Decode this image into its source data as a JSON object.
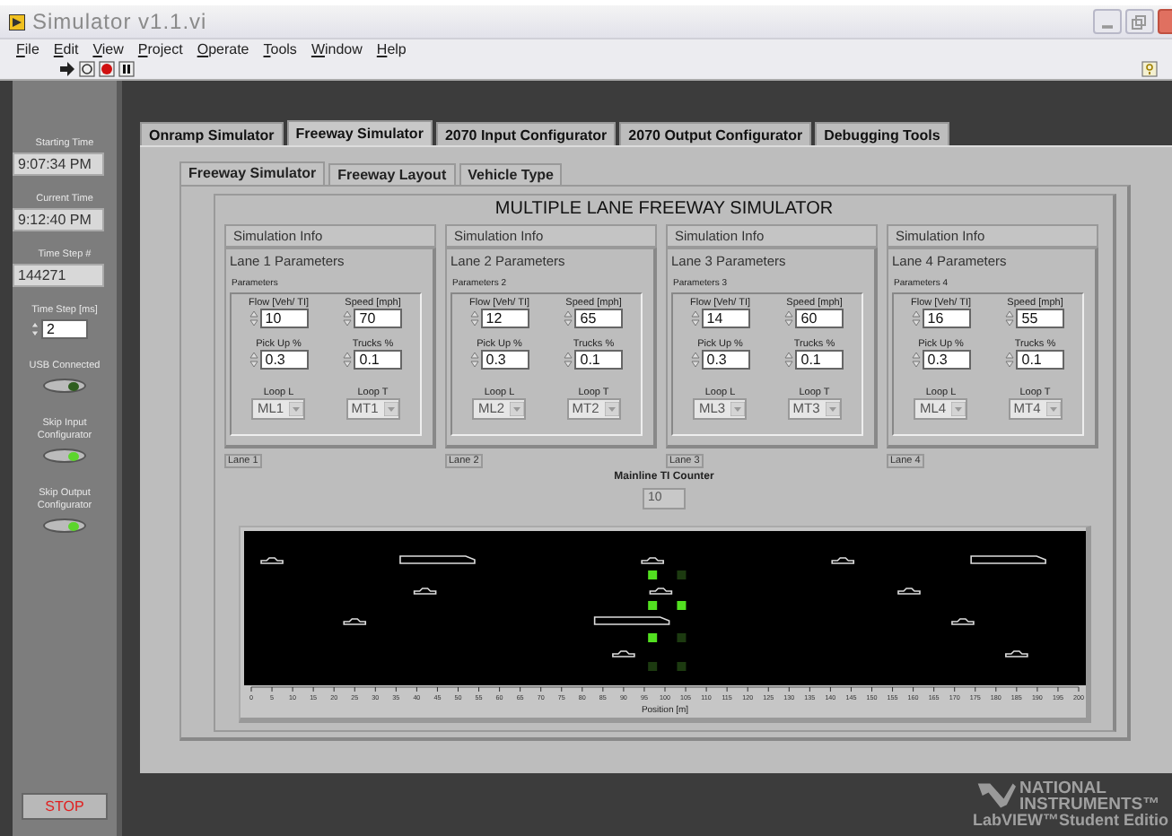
{
  "window": {
    "title": "Simulator v1.1.vi"
  },
  "menu": [
    "File",
    "Edit",
    "View",
    "Project",
    "Operate",
    "Tools",
    "Window",
    "Help"
  ],
  "side_panel": {
    "displays": [
      {
        "label": "Starting Time",
        "value": "9:07:34 PM"
      },
      {
        "label": "Current Time",
        "value": "9:12:40 PM"
      },
      {
        "label": "Time Step #",
        "value": "144271"
      }
    ],
    "time_step": {
      "label": "Time Step [ms]",
      "value": "2"
    },
    "leds": [
      {
        "label": "USB Connected",
        "on": false
      },
      {
        "label": "Skip Input Configurator",
        "on": true
      },
      {
        "label": "Skip Output Configurator",
        "on": true
      }
    ],
    "stop_button": "STOP"
  },
  "tabs": [
    {
      "label": "Onramp Simulator",
      "selected": false
    },
    {
      "label": "Freeway Simulator",
      "selected": true
    },
    {
      "label": "2070 Input Configurator",
      "selected": false
    },
    {
      "label": "2070 Output Configurator",
      "selected": false
    },
    {
      "label": "Debugging Tools",
      "selected": false
    }
  ],
  "sub_tabs": [
    {
      "label": "Freeway Simulator",
      "selected": true
    },
    {
      "label": "Freeway Layout",
      "selected": false
    },
    {
      "label": "Vehicle Type",
      "selected": false
    }
  ],
  "panel_title": "MULTIPLE LANE FREEWAY SIMULATOR",
  "lanes": [
    {
      "tab": "Simulation Info",
      "title": "Lane 1 Parameters",
      "cluster": "Parameters",
      "fields": [
        {
          "label": "Flow [Veh/ TI]",
          "value": "10"
        },
        {
          "label": "Speed [mph]",
          "value": "70"
        },
        {
          "label": "Pick Up %",
          "value": "0.3"
        },
        {
          "label": "Trucks %",
          "value": "0.1"
        }
      ],
      "loops": [
        {
          "label": "Loop L",
          "value": "ML1"
        },
        {
          "label": "Loop T",
          "value": "MT1"
        }
      ],
      "caption": "Lane 1"
    },
    {
      "tab": "Simulation Info",
      "title": "Lane 2 Parameters",
      "cluster": "Parameters 2",
      "fields": [
        {
          "label": "Flow [Veh/ TI]",
          "value": "12"
        },
        {
          "label": "Speed [mph]",
          "value": "65"
        },
        {
          "label": "Pick Up %",
          "value": "0.3"
        },
        {
          "label": "Trucks %",
          "value": "0.1"
        }
      ],
      "loops": [
        {
          "label": "Loop L",
          "value": "ML2"
        },
        {
          "label": "Loop T",
          "value": "MT2"
        }
      ],
      "caption": "Lane 2"
    },
    {
      "tab": "Simulation Info",
      "title": "Lane 3 Parameters",
      "cluster": "Parameters 3",
      "fields": [
        {
          "label": "Flow [Veh/ TI]",
          "value": "14"
        },
        {
          "label": "Speed [mph]",
          "value": "60"
        },
        {
          "label": "Pick Up %",
          "value": "0.3"
        },
        {
          "label": "Trucks %",
          "value": "0.1"
        }
      ],
      "loops": [
        {
          "label": "Loop L",
          "value": "ML3"
        },
        {
          "label": "Loop T",
          "value": "MT3"
        }
      ],
      "caption": "Lane 3"
    },
    {
      "tab": "Simulation Info",
      "title": "Lane 4 Parameters",
      "cluster": "Parameters 4",
      "fields": [
        {
          "label": "Flow [Veh/ TI]",
          "value": "16"
        },
        {
          "label": "Speed [mph]",
          "value": "55"
        },
        {
          "label": "Pick Up %",
          "value": "0.3"
        },
        {
          "label": "Trucks %",
          "value": "0.1"
        }
      ],
      "loops": [
        {
          "label": "Loop L",
          "value": "ML4"
        },
        {
          "label": "Loop T",
          "value": "MT4"
        }
      ],
      "caption": "Lane 4"
    }
  ],
  "counter": {
    "label": "Mainline TI Counter",
    "value": "10"
  },
  "road": {
    "axis_label": "Position [m]",
    "ticks": [
      "0",
      "5",
      "10",
      "15",
      "20",
      "25",
      "30",
      "35",
      "40",
      "45",
      "50",
      "55",
      "60",
      "65",
      "70",
      "75",
      "80",
      "85",
      "90",
      "95",
      "100",
      "105",
      "110",
      "115",
      "120",
      "125",
      "130",
      "135",
      "140",
      "145",
      "150",
      "155",
      "160",
      "165",
      "170",
      "175",
      "180",
      "185",
      "190",
      "195",
      "200"
    ],
    "detector_rows": [
      {
        "detectors": [
          {
            "on": true
          },
          {
            "on": false
          }
        ]
      },
      {
        "detectors": [
          {
            "on": true
          },
          {
            "on": true
          }
        ]
      },
      {
        "detectors": [
          {
            "on": true
          },
          {
            "on": false
          }
        ]
      },
      {
        "detectors": [
          {
            "on": false
          },
          {
            "on": false
          }
        ]
      }
    ]
  },
  "brand": {
    "lines": [
      "NATIONAL",
      "INSTRUMENTS™",
      "LabVIEW™Student Editio"
    ]
  }
}
